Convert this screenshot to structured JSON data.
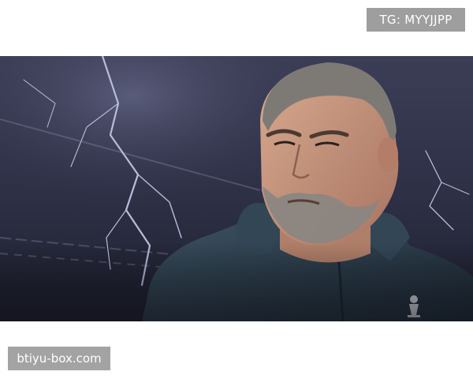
{
  "watermark_top": {
    "text": "TG: MYYJJPP"
  },
  "photo": {
    "subject": "man-in-dark-jacket",
    "colors": {
      "sky": "#2d2f45",
      "lightning": "#b9bdd8",
      "jacket": "#2a3a48",
      "skin": "#c7957c",
      "hair": "#7d7a76"
    }
  },
  "watermark_bottom": {
    "text": "btiyu-box.com"
  }
}
